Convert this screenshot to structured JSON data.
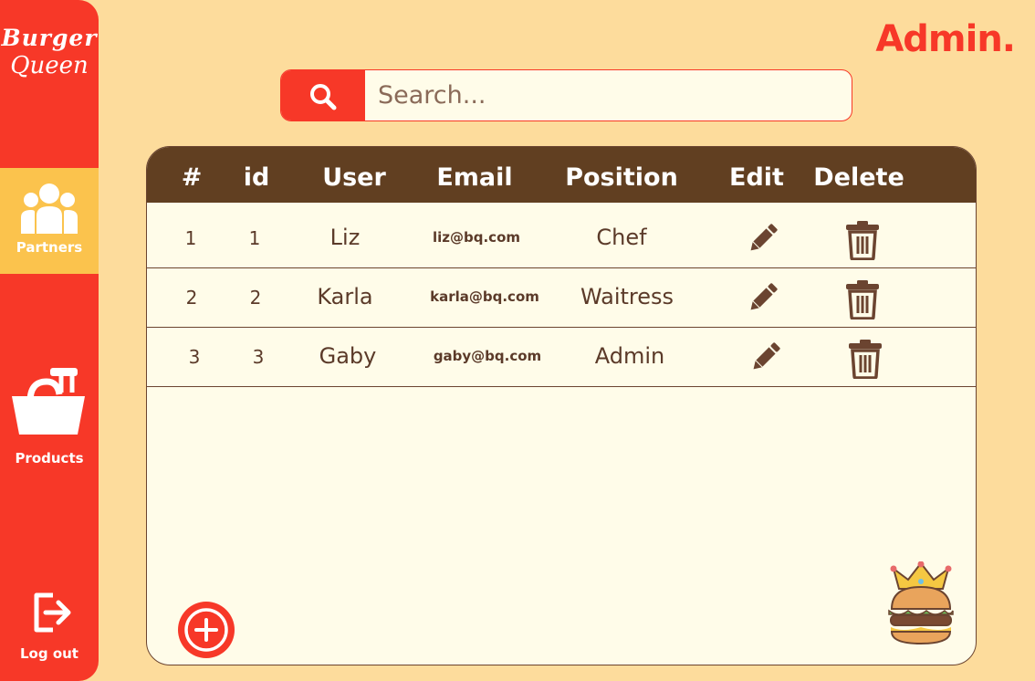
{
  "brand": {
    "line1": "Burger",
    "line2": "Queen"
  },
  "header": {
    "admin_label": "Admin."
  },
  "search": {
    "placeholder": "Search..."
  },
  "nav": {
    "partners": "Partners",
    "products": "Products",
    "logout": "Log out"
  },
  "table": {
    "headers": [
      "#",
      "id",
      "User",
      "Email",
      "Position",
      "Edit",
      "Delete"
    ],
    "rows": [
      {
        "n": "1",
        "id": "1",
        "user": "Liz",
        "email": "liz@bq.com",
        "position": "Chef"
      },
      {
        "n": "2",
        "id": "2",
        "user": "Karla",
        "email": "karla@bq.com",
        "position": "Waitress"
      },
      {
        "n": "3",
        "id": "3",
        "user": "Gaby",
        "email": "gaby@bq.com",
        "position": "Admin"
      }
    ]
  },
  "icons": {
    "search": "search-icon",
    "partners": "users-icon",
    "products": "basket-icon",
    "logout": "logout-icon",
    "edit": "pencil-icon",
    "delete": "trash-icon",
    "add": "plus-circle-icon",
    "mascot": "crowned-burger-icon"
  },
  "colors": {
    "background": "#fddc9c",
    "accent": "#f73828",
    "active": "#fbc34d",
    "header": "#613f21",
    "panel": "#fffce9",
    "text": "#5b3a29"
  }
}
